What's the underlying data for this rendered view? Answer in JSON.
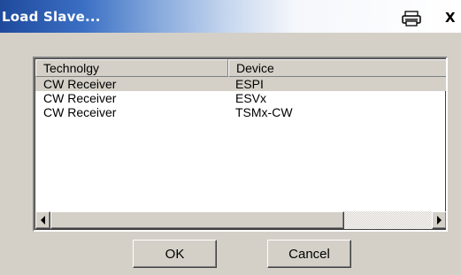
{
  "window": {
    "title": "Load Slave...",
    "close_glyph": "X",
    "icons": {
      "print": "printer-icon",
      "close": "close-icon"
    }
  },
  "list": {
    "columns": [
      "Technolgy",
      "Device"
    ],
    "rows": [
      {
        "technology": "CW Receiver",
        "device": "ESPI",
        "selected": true
      },
      {
        "technology": "CW Receiver",
        "device": "ESVx",
        "selected": false
      },
      {
        "technology": "CW Receiver",
        "device": "TSMx-CW",
        "selected": false
      }
    ],
    "scrollbar": {
      "icons": {
        "left": "scroll-left-arrow-icon",
        "right": "scroll-right-arrow-icon"
      }
    }
  },
  "buttons": {
    "ok": "OK",
    "cancel": "Cancel"
  },
  "colors": {
    "dialog_face": "#d4d0c8",
    "title_gradient_start": "#1f4a9c",
    "title_text": "#ffffff",
    "selected_row": "#d4d0c8"
  }
}
